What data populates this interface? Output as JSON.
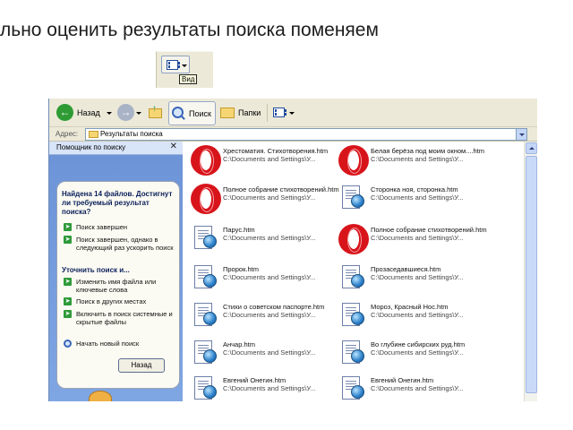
{
  "slide": {
    "title": "льно оценить результаты поиска поменяем",
    "callout_tooltip": "Вид"
  },
  "toolbar": {
    "back_label": "Назад",
    "search_label": "Поиск",
    "folders_label": "Папки"
  },
  "address": {
    "label": "Адрес:",
    "value": "Результаты поиска"
  },
  "pane": {
    "title": "Помощник по поиску",
    "found_heading": "Найдена 14 файлов. Достигнут ли требуемый результат поиска?",
    "options_1": [
      "Поиск завершен",
      "Поиск завершен, однако в следующий раз ускорить поиск"
    ],
    "refine_heading": "Уточнить поиск и...",
    "options_2": [
      "Изменить имя файла или ключевые слова",
      "Поиск в других местах",
      "Включить в поиск системные и скрытые файлы"
    ],
    "new_search": "Начать новый поиск",
    "back_button": "Назад"
  },
  "results": [
    {
      "name": "Хрестоматия. Стихотворения.htm",
      "path": "C:\\Documents and Settings\\У...",
      "icon": "opera-icon"
    },
    {
      "name": "Белая берёза под моим окном....htm",
      "path": "C:\\Documents and Settings\\У...",
      "icon": "opera-icon"
    },
    {
      "name": "Полное собрание стихотворений.htm",
      "path": "C:\\Documents and Settings\\У...",
      "icon": "opera-icon"
    },
    {
      "name": "Сторонка ноя, сторонка.htm",
      "path": "C:\\Documents and Settings\\У...",
      "icon": "html-doc-icon"
    },
    {
      "name": "Парус.htm",
      "path": "C:\\Documents and Settings\\У...",
      "icon": "html-doc-icon"
    },
    {
      "name": "Полное собрание стихотворений.htm",
      "path": "C:\\Documents and Settings\\У...",
      "icon": "opera-icon"
    },
    {
      "name": "Пророк.htm",
      "path": "C:\\Documents and Settings\\У...",
      "icon": "html-doc-icon"
    },
    {
      "name": "Прозаседавшиеся.htm",
      "path": "C:\\Documents and Settings\\У...",
      "icon": "html-doc-icon"
    },
    {
      "name": "Стихи о советском паспорте.htm",
      "path": "C:\\Documents and Settings\\У...",
      "icon": "html-doc-icon"
    },
    {
      "name": "Мороз, Красный Нос.htm",
      "path": "C:\\Documents and Settings\\У...",
      "icon": "html-doc-icon"
    },
    {
      "name": "Анчар.htm",
      "path": "C:\\Documents and Settings\\У...",
      "icon": "html-doc-icon"
    },
    {
      "name": "Во глубине сибирских руд.htm",
      "path": "C:\\Documents and Settings\\У...",
      "icon": "html-doc-icon"
    },
    {
      "name": "Евгений Онегин.htm",
      "path": "C:\\Documents and Settings\\У...",
      "icon": "html-doc-icon"
    },
    {
      "name": "Евгений Онегин.htm",
      "path": "C:\\Documents and Settings\\У...",
      "icon": "html-doc-icon"
    }
  ],
  "colors": {
    "toolbar_bg": "#ece9d8",
    "pane_bg": "#7fa6e3",
    "opera_red": "#d8141b",
    "action_green": "#2f9a3a"
  }
}
